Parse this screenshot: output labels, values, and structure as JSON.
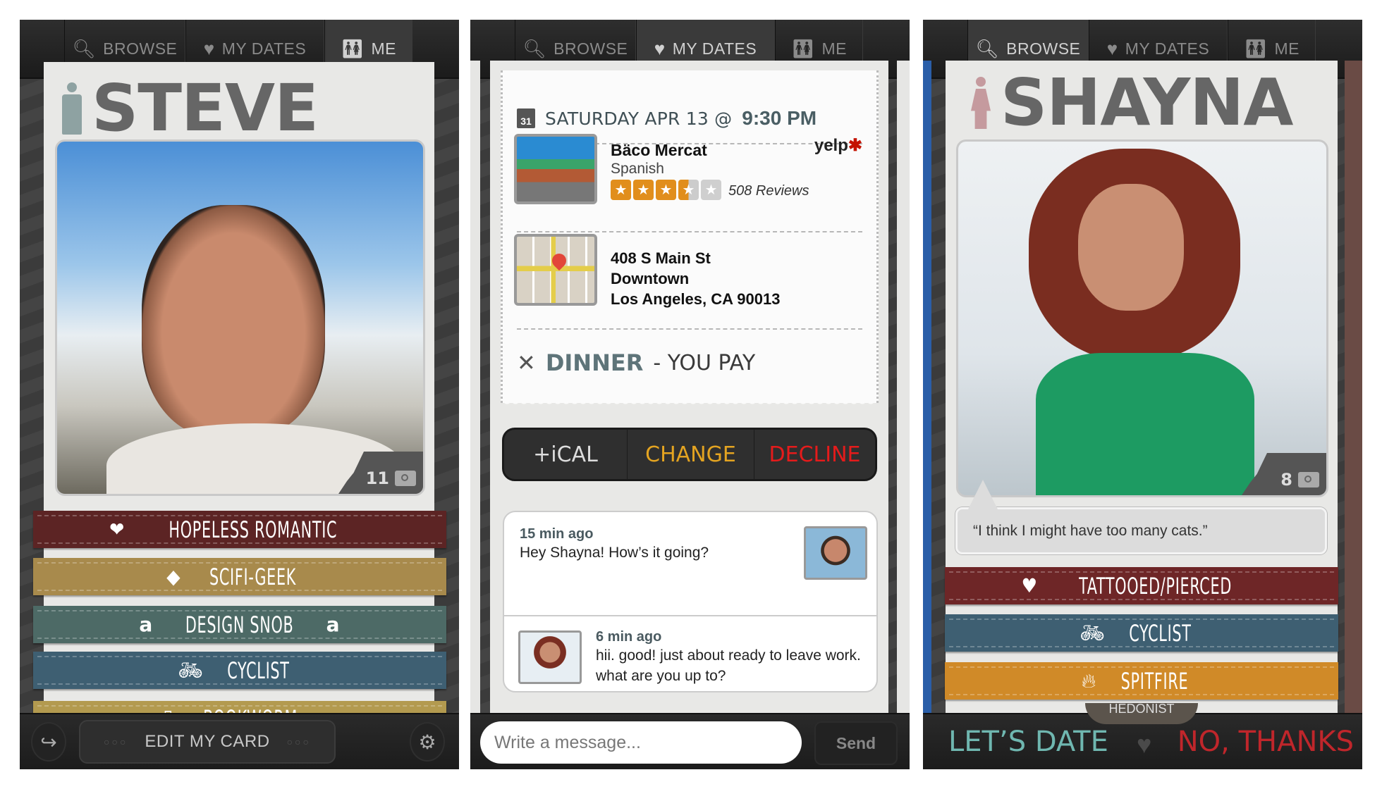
{
  "nav": {
    "browse": "BROWSE",
    "my_dates": "MY DATES",
    "me": "ME"
  },
  "profile_me": {
    "name": "STEVE",
    "gender_icon": "male-icon",
    "photo_count": "11",
    "tags": [
      {
        "label": "HOPELESS ROMANTIC",
        "icon": "broken-heart-icon",
        "color": "#5c2424"
      },
      {
        "label": "SCIFI-GEEK",
        "icon": "ufo-icon",
        "color": "#a88a4c"
      },
      {
        "label": "DESIGN SNOB",
        "icon": "font-a-icon",
        "color": "#4d6a66"
      },
      {
        "label": "CYCLIST",
        "icon": "bicycle-icon",
        "color": "#3e5f72"
      },
      {
        "label": "BOOKWORM",
        "icon": "book-icon",
        "color": "#b39a4f"
      }
    ],
    "edit_button": "EDIT MY CARD"
  },
  "date": {
    "day": "SATURDAY APR 13 @",
    "time": "9:30 PM",
    "calendar_day": "31",
    "restaurant": {
      "name": "Bäco Mercat",
      "category": "Spanish",
      "rating": 3.5,
      "rating_max": 5,
      "reviews": "508 Reviews",
      "source": "yelp"
    },
    "address": {
      "line1": "408 S Main St",
      "line2": "Downtown",
      "line3": "Los Angeles, CA 90013"
    },
    "type_bold": "DINNER",
    "type_rest": "- YOU PAY",
    "actions": {
      "ical": "+iCAL",
      "change": "CHANGE",
      "decline": "DECLINE"
    },
    "messages": [
      {
        "time": "15 min ago",
        "text": "Hey Shayna! How’s it going?",
        "sender": "Steve"
      },
      {
        "time": "6 min ago",
        "text": "hii. good! just about ready to leave work. what are you up to?",
        "sender": "Shayna"
      }
    ],
    "input_placeholder": "Write a message...",
    "send_label": "Send"
  },
  "profile_browse": {
    "name": "SHAYNA",
    "gender_icon": "female-icon",
    "photo_count": "8",
    "quote": "“I think I might have too many cats.”",
    "tags": [
      {
        "label": "TATTOOED/PIERCED",
        "icon": "heart-banner-icon",
        "color": "#6e2627"
      },
      {
        "label": "CYCLIST",
        "icon": "bicycle-icon",
        "color": "#3e5f72"
      },
      {
        "label": "SPITFIRE",
        "icon": "flame-icon",
        "color": "#d08a28"
      }
    ],
    "next_tag_peek": "HEDONIST",
    "yes_label": "LET’S DATE",
    "no_label": "NO, THANKS"
  }
}
